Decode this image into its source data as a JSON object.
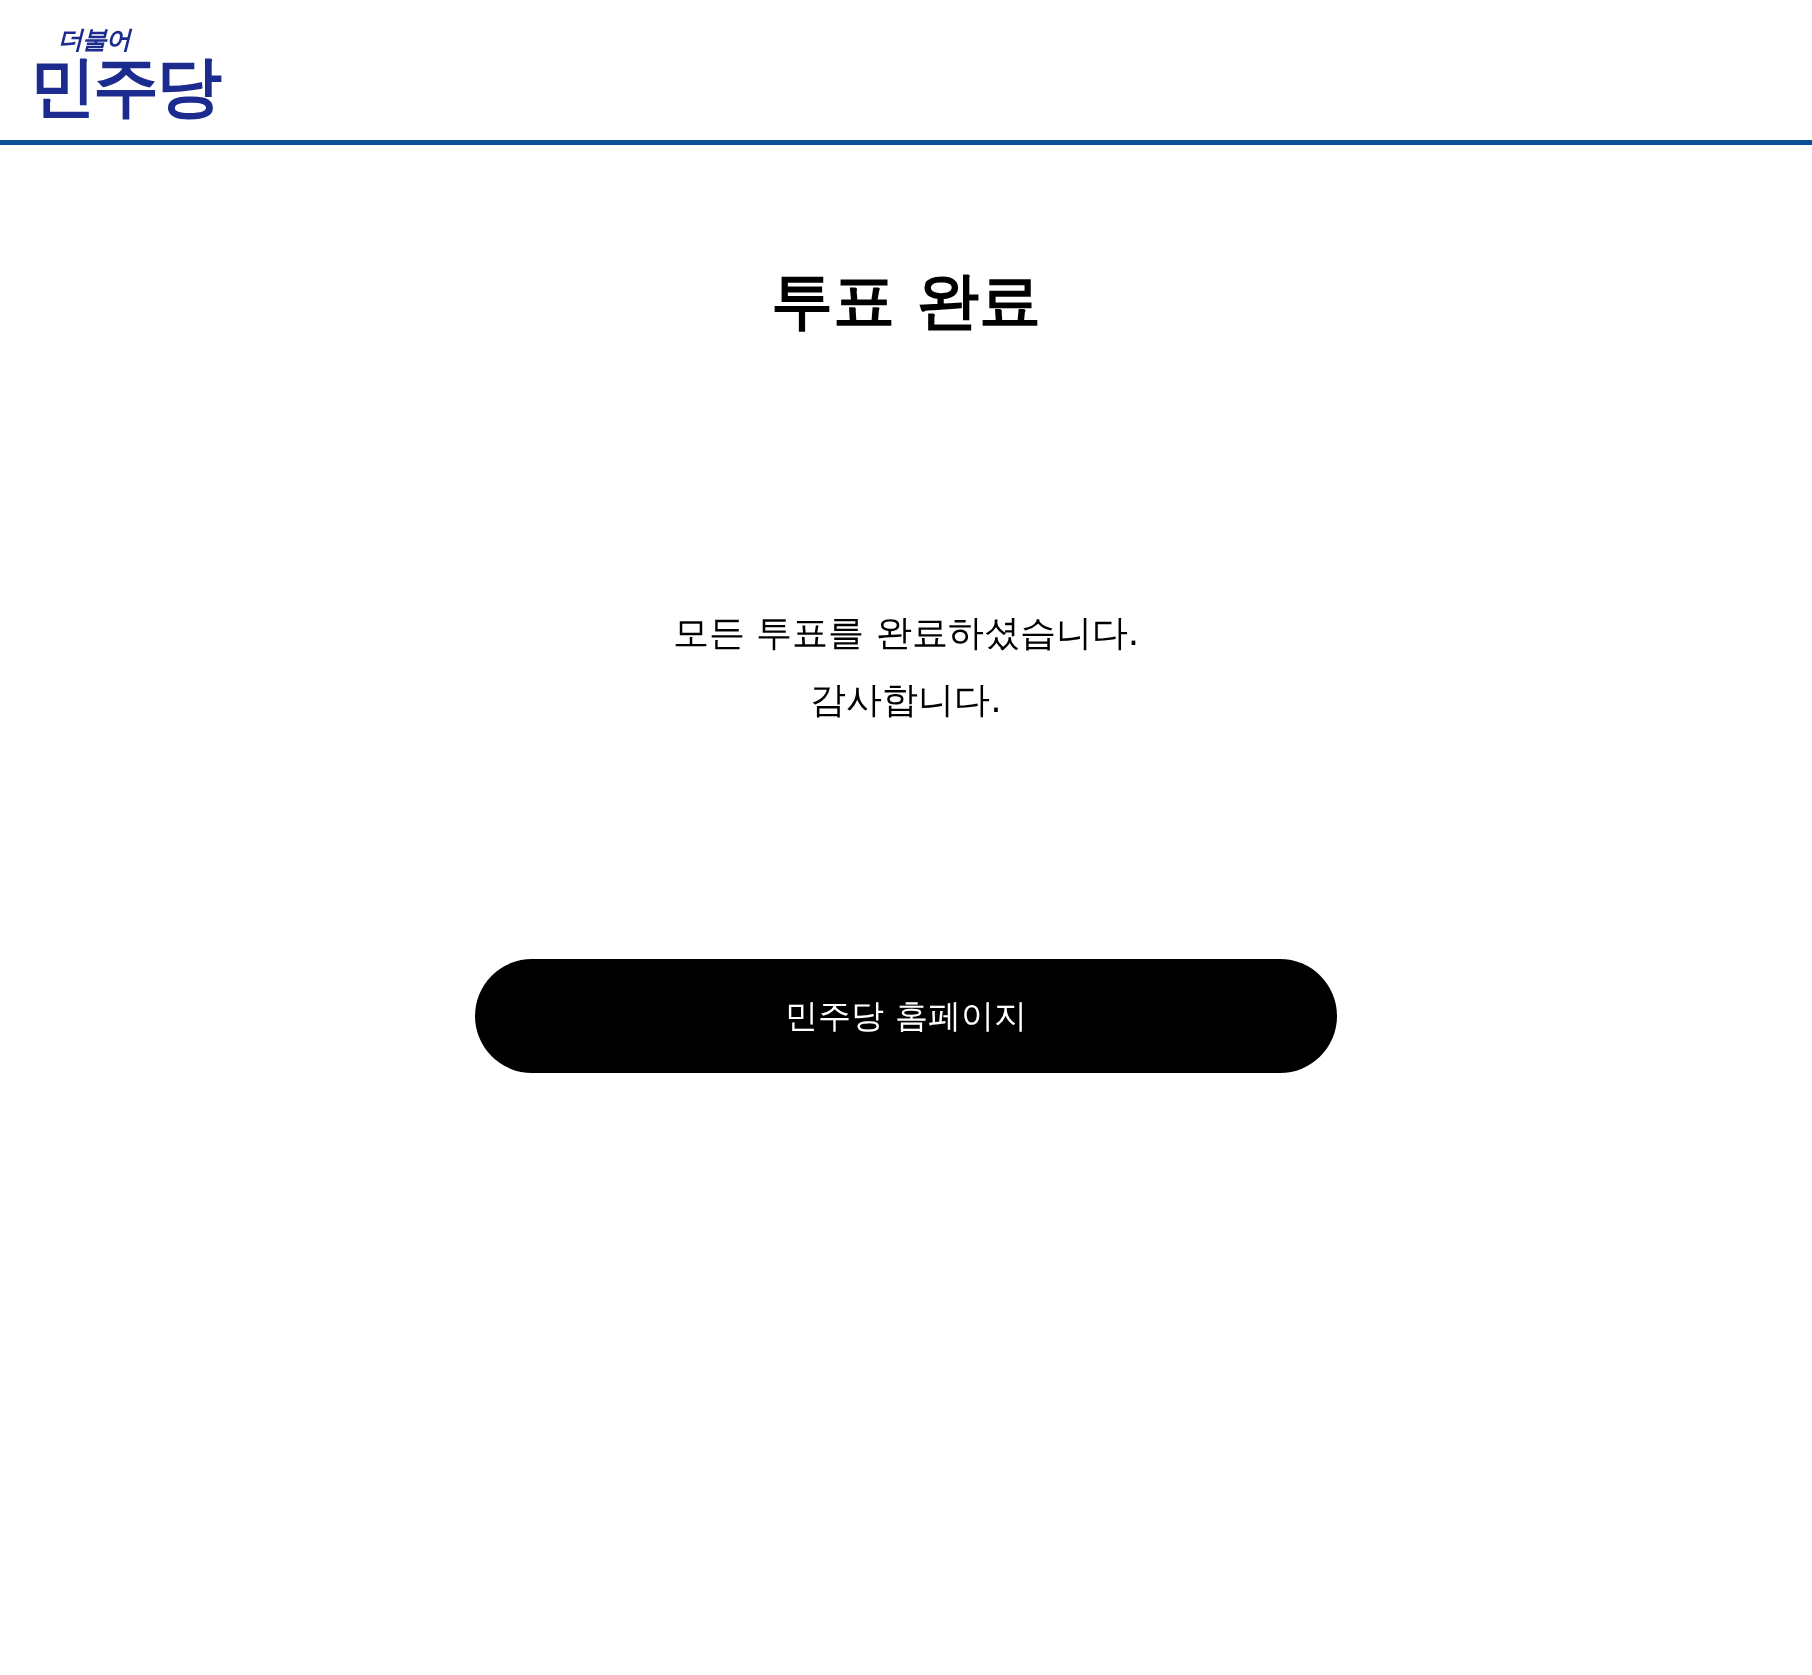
{
  "header": {
    "logo": {
      "tagline": "더불어",
      "name": "민주당"
    }
  },
  "title": "투표 완료",
  "message": [
    "모든 투표를 완료하셨습니다.",
    "감사합니다."
  ],
  "button": {
    "label": "민주당 홈페이지"
  }
}
